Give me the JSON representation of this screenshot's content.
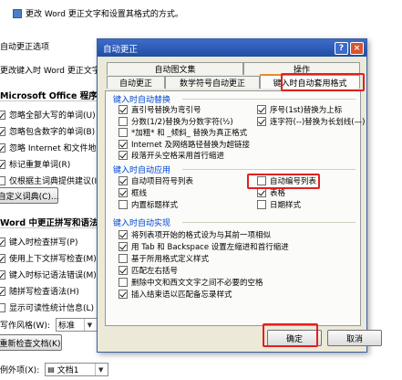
{
  "background": {
    "title": "更改 Word 更正文字和设置其格式的方式。",
    "autocorrect_heading": "自动更正选项",
    "autocorrect_desc": "更改键入时 Word 更正文字和",
    "office_heading": "Microsoft Office 程序中",
    "office_checks": [
      {
        "label": "忽略全部大写的单词(U)",
        "checked": true
      },
      {
        "label": "忽略包含数字的单词(B)",
        "checked": true
      },
      {
        "label": "忽略 Internet 和文件地址",
        "checked": true
      },
      {
        "label": "标记重复单词(R)",
        "checked": true
      },
      {
        "label": "仅根据主词典提供建议(I)",
        "checked": false
      }
    ],
    "custom_dict_btn": "自定义词典(C)...",
    "word_heading": "Word 中更正拼写和语法时",
    "word_checks": [
      {
        "label": "键入时检查拼写(P)",
        "checked": true
      },
      {
        "label": "使用上下文拼写检查(M)",
        "checked": true
      },
      {
        "label": "键入时标记语法错误(M)",
        "checked": true
      },
      {
        "label": "随拼写检查语法(H)",
        "checked": true
      },
      {
        "label": "显示可读性统计信息(L)",
        "checked": false
      }
    ],
    "style_label": "写作风格(W):",
    "style_value": "标准",
    "recheck_btn": "重新检查文档(K)",
    "exception_label": "例外项(X):",
    "exception_value": "文档1"
  },
  "dialog": {
    "title": "自动更正",
    "help_btn": "?",
    "close_btn": "×",
    "tabs_top": [
      "自动图文集",
      "操作"
    ],
    "tabs_bottom": [
      "自动更正",
      "数学符号自动更正",
      "键入时自动套用格式"
    ],
    "sections": {
      "replace": {
        "title": "键入时自动替换",
        "left": [
          {
            "label": "直引号替换为弯引号",
            "checked": true
          },
          {
            "label": "分数(1/2)替换为分数字符(½)",
            "checked": false
          },
          {
            "label": "*加粗* 和 _倾斜_ 替换为真正格式",
            "checked": false
          },
          {
            "label": "Internet 及网络路径替换为超链接",
            "checked": true
          },
          {
            "label": "段落开头空格采用首行缩进",
            "checked": true
          }
        ],
        "right": [
          {
            "label": "序号(1st)替换为上标",
            "checked": true
          },
          {
            "label": "连字符(--)替换为长划线(—)",
            "checked": true
          }
        ]
      },
      "apply": {
        "title": "键入时自动应用",
        "left": [
          {
            "label": "自动项目符号列表",
            "checked": true
          },
          {
            "label": "框线",
            "checked": true
          },
          {
            "label": "内置标题样式",
            "checked": false
          }
        ],
        "right": [
          {
            "label": "自动编号列表",
            "checked": false
          },
          {
            "label": "表格",
            "checked": true
          },
          {
            "label": "日期样式",
            "checked": false
          }
        ]
      },
      "implement": {
        "title": "键入时自动实现",
        "items": [
          {
            "label": "将列表项开始的格式设为与其前一项相似",
            "checked": true
          },
          {
            "label": "用 Tab 和 Backspace 设置左缩进和首行缩进",
            "checked": true
          },
          {
            "label": "基于所用格式定义样式",
            "checked": false
          },
          {
            "label": "匹配左右括号",
            "checked": true
          },
          {
            "label": "删除中文和西文文字之间不必要的空格",
            "checked": false
          },
          {
            "label": "插入结束语以匹配备忘录样式",
            "checked": true
          }
        ]
      }
    },
    "ok_btn": "确定",
    "cancel_btn": "取消"
  },
  "colors": {
    "highlight": "#e02020",
    "titlebar": "#1f4ea3",
    "section_text": "#0046d5"
  }
}
